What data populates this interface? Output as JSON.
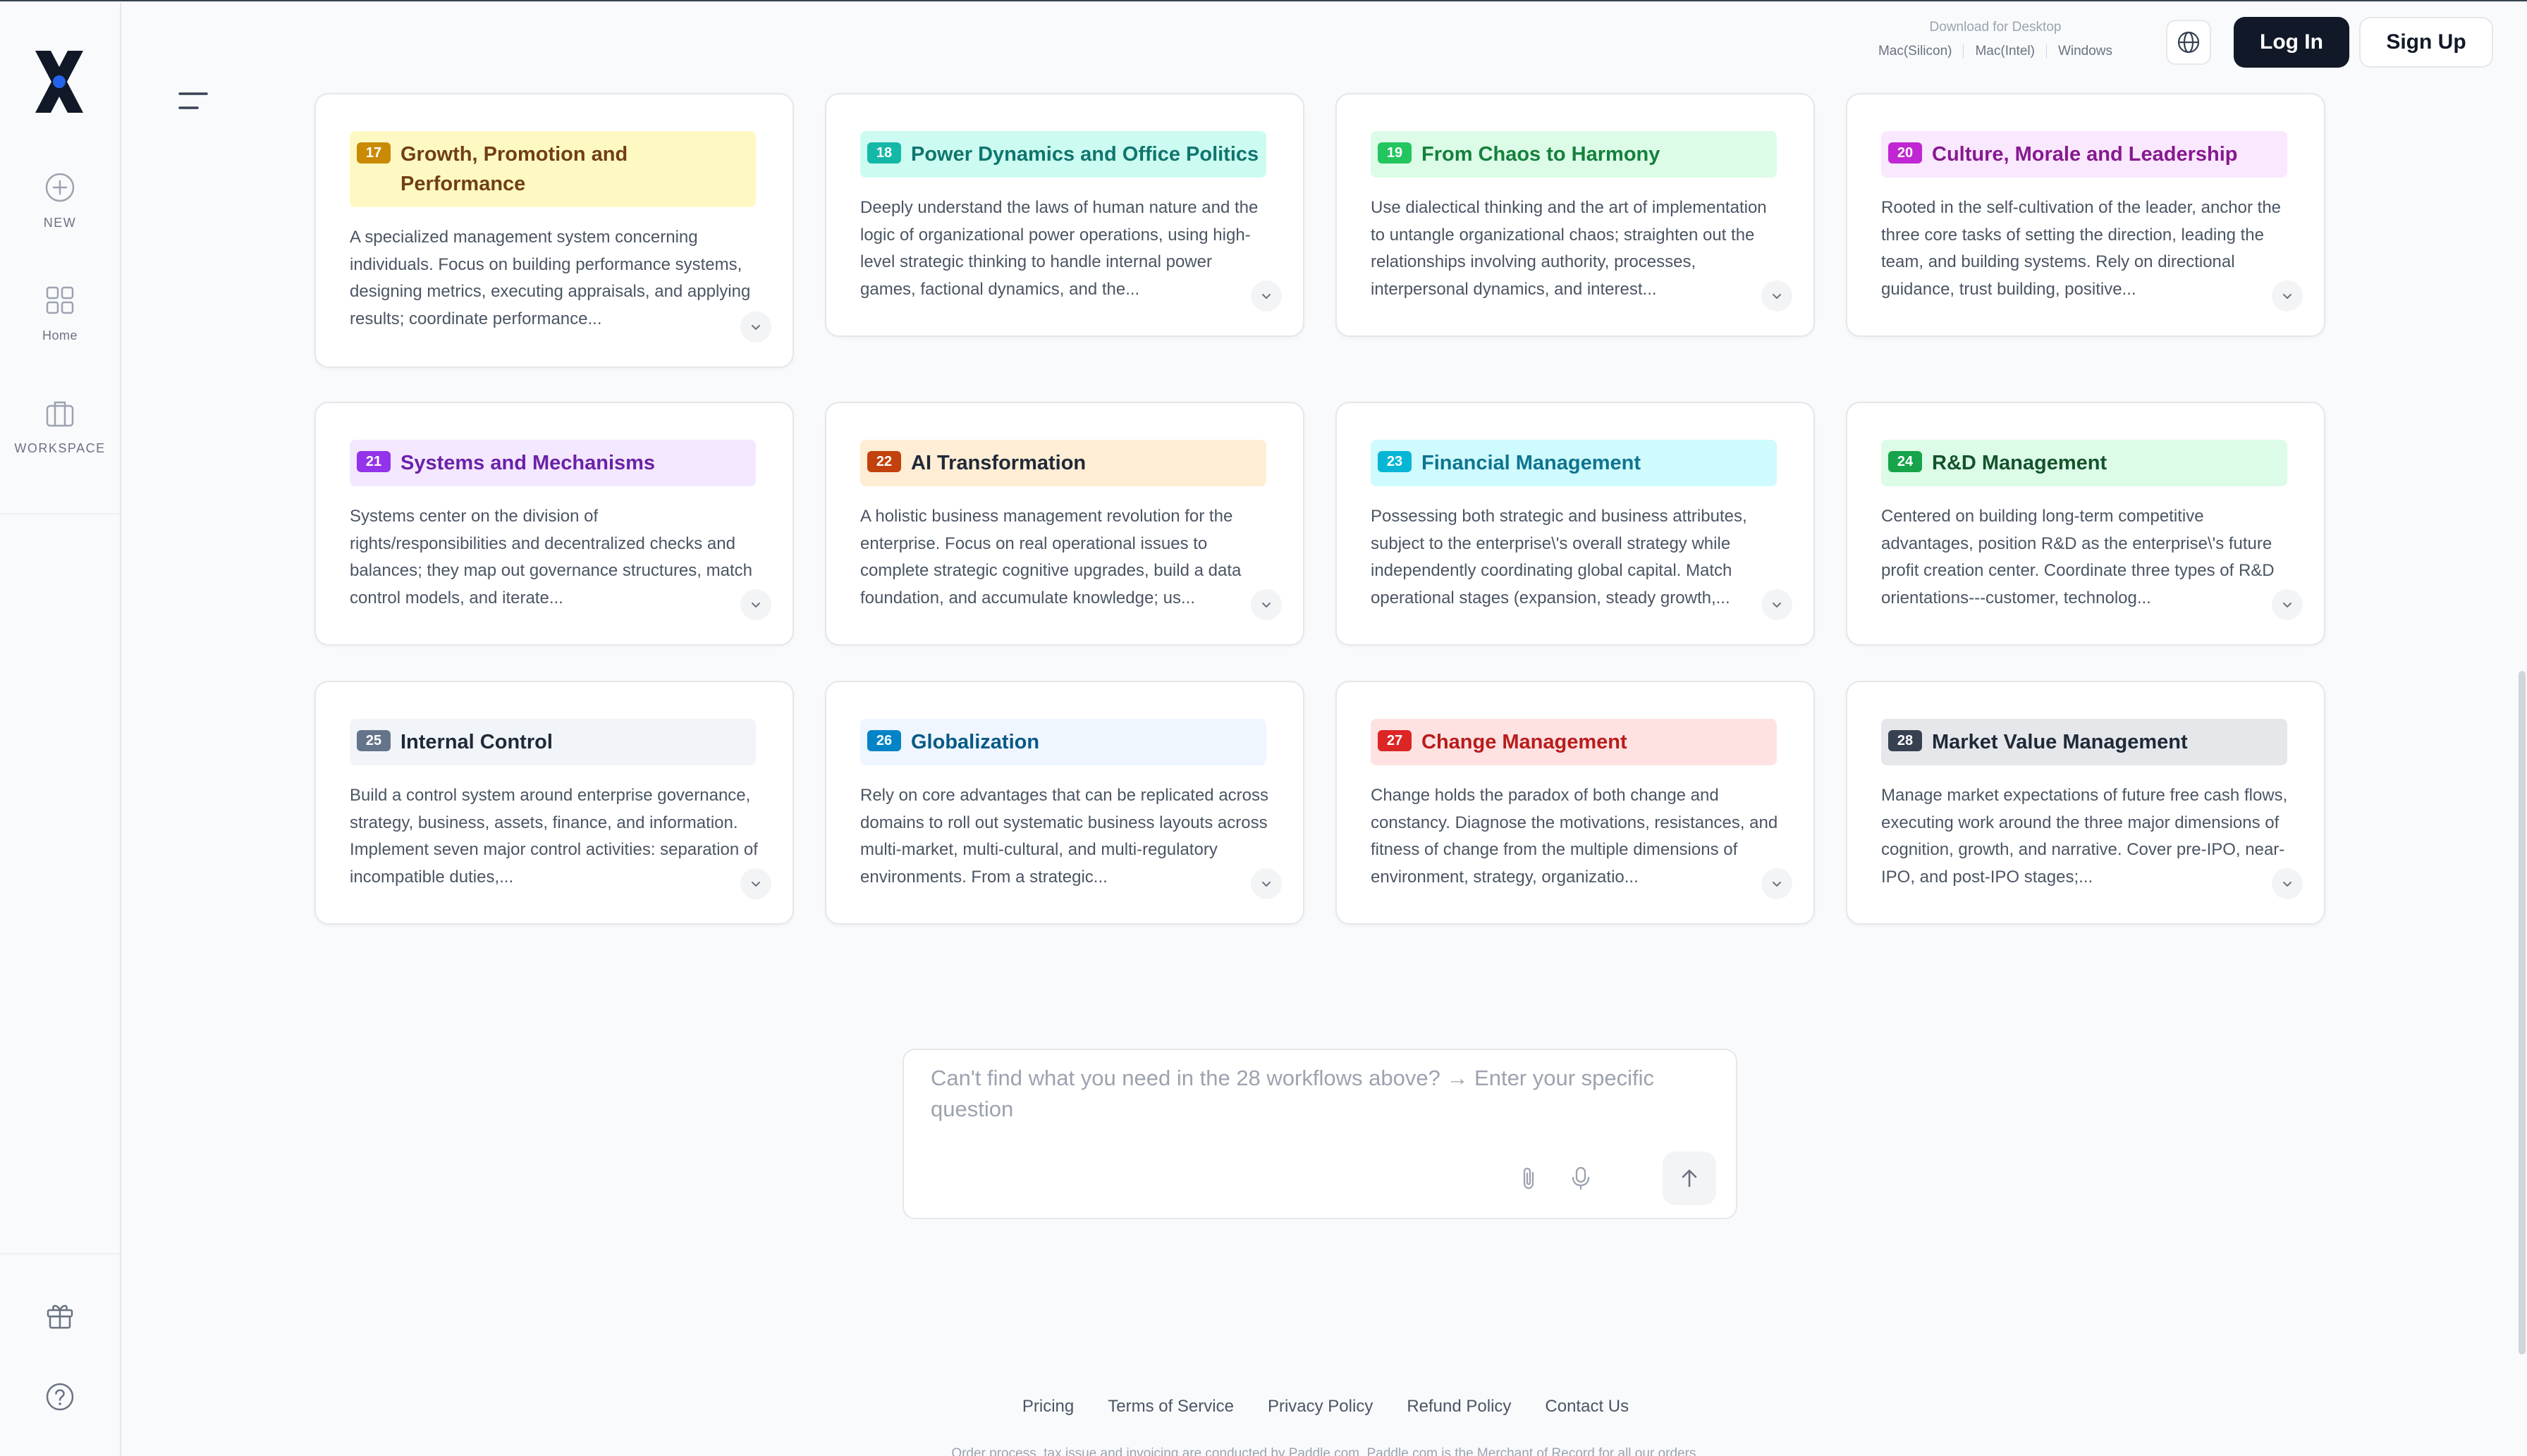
{
  "rail": {
    "new_label": "NEW",
    "home_label": "Home",
    "workspace_label": "WORKSPACE"
  },
  "header": {
    "download_title": "Download for Desktop",
    "download_links": [
      "Mac(Silicon)",
      "Mac(Intel)",
      "Windows"
    ],
    "login_label": "Log In",
    "signup_label": "Sign Up"
  },
  "cards": [
    {
      "num": "17",
      "title": "Growth, Promotion and Performance",
      "desc": "A specialized management system concerning individuals. Focus on building performance systems, designing metrics, executing appraisals, and applying results; coordinate performance...",
      "accent": "#ca8a04",
      "tint": "#fef9c3",
      "text": "#713f12"
    },
    {
      "num": "18",
      "title": "Power Dynamics and Office Politics",
      "desc": "Deeply understand the laws of human nature and the logic of organizational power operations, using high-level strategic thinking to handle internal power games, factional dynamics, and the...",
      "accent": "#14b8a6",
      "tint": "#ccfbf1",
      "text": "#0f766e"
    },
    {
      "num": "19",
      "title": "From Chaos to Harmony",
      "desc": "Use dialectical thinking and the art of implementation to untangle organizational chaos; straighten out the relationships involving authority, processes, interpersonal dynamics, and interest...",
      "accent": "#22c55e",
      "tint": "#dcfce7",
      "text": "#15803d"
    },
    {
      "num": "20",
      "title": "Culture, Morale and Leadership",
      "desc": "Rooted in the self-cultivation of the leader, anchor the three core tasks of setting the direction, leading the team, and building systems. Rely on directional guidance, trust building, positive...",
      "accent": "#c026d3",
      "tint": "#fae8ff",
      "text": "#86198f"
    },
    {
      "num": "21",
      "title": "Systems and Mechanisms",
      "desc": "Systems center on the division of rights/responsibilities and decentralized checks and balances; they map out governance structures, match control models, and iterate...",
      "accent": "#9333ea",
      "tint": "#f3e8ff",
      "text": "#6b21a8"
    },
    {
      "num": "22",
      "title": "AI Transformation",
      "desc": "A holistic business management revolution for the enterprise. Focus on real operational issues to complete strategic cognitive upgrades, build a data foundation, and accumulate knowledge; us...",
      "accent": "#c2410c",
      "tint": "#ffedd5",
      "text": "#1f2937"
    },
    {
      "num": "23",
      "title": "Financial Management",
      "desc": "Possessing both strategic and business attributes, subject to the enterprise\\'s overall strategy while independently coordinating global capital. Match operational stages (expansion, steady growth,...",
      "accent": "#06b6d4",
      "tint": "#cffafe",
      "text": "#0e7490"
    },
    {
      "num": "24",
      "title": "R&D Management",
      "desc": "Centered on building long-term competitive advantages, position R&D as the enterprise\\'s future profit creation center. Coordinate three types of R&D orientations---customer, technolog...",
      "accent": "#16a34a",
      "tint": "#dcfce7",
      "text": "#14532d"
    },
    {
      "num": "25",
      "title": "Internal Control",
      "desc": "Build a control system around enterprise governance, strategy, business, assets, finance, and information. Implement seven major control activities: separation of incompatible duties,...",
      "accent": "#64748b",
      "tint": "#f1f5f9",
      "text": "#1f2937"
    },
    {
      "num": "26",
      "title": "Globalization",
      "desc": "Rely on core advantages that can be replicated across domains to roll out systematic business layouts across multi-market, multi-cultural, and multi-regulatory environments. From a strategic...",
      "accent": "#0284c7",
      "tint": "#eff6ff",
      "text": "#075985"
    },
    {
      "num": "27",
      "title": "Change Management",
      "desc": "Change holds the paradox of both change and constancy. Diagnose the motivations, resistances, and fitness of change from the multiple dimensions of environment, strategy, organizatio...",
      "accent": "#dc2626",
      "tint": "#fee2e2",
      "text": "#b91c1c"
    },
    {
      "num": "28",
      "title": "Market Value Management",
      "desc": "Manage market expectations of future free cash flows, executing work around the three major dimensions of cognition, growth, and narrative. Cover pre-IPO, near-IPO, and post-IPO stages;...",
      "accent": "#374151",
      "tint": "#e5e7eb",
      "text": "#1f2937"
    }
  ],
  "ask": {
    "placeholder": "Can't find what you need in the 28 workflows above? → Enter your specific question",
    "value": ""
  },
  "footer": {
    "links": [
      "Pricing",
      "Terms of Service",
      "Privacy Policy",
      "Refund Policy",
      "Contact Us"
    ],
    "note": "Order process, tax issue and invoicing are conducted by Paddle.com. Paddle.com is the Merchant of Record for all our orders."
  }
}
